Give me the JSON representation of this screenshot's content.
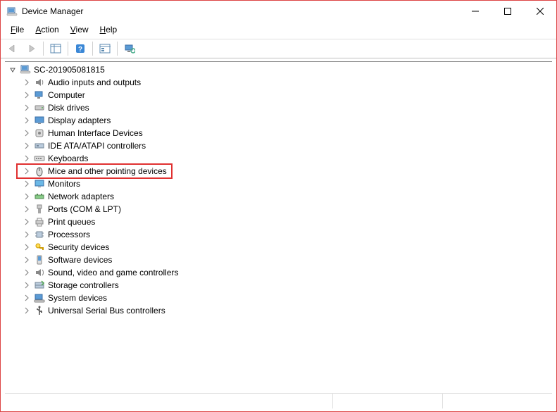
{
  "window": {
    "title": "Device Manager"
  },
  "menu": {
    "file": "File",
    "action": "Action",
    "view": "View",
    "help": "Help"
  },
  "tree": {
    "root": "SC-201905081815",
    "items": [
      "Audio inputs and outputs",
      "Computer",
      "Disk drives",
      "Display adapters",
      "Human Interface Devices",
      "IDE ATA/ATAPI controllers",
      "Keyboards",
      "Mice and other pointing devices",
      "Monitors",
      "Network adapters",
      "Ports (COM & LPT)",
      "Print queues",
      "Processors",
      "Security devices",
      "Software devices",
      "Sound, video and game controllers",
      "Storage controllers",
      "System devices",
      "Universal Serial Bus controllers"
    ],
    "highlighted_index": 7
  }
}
